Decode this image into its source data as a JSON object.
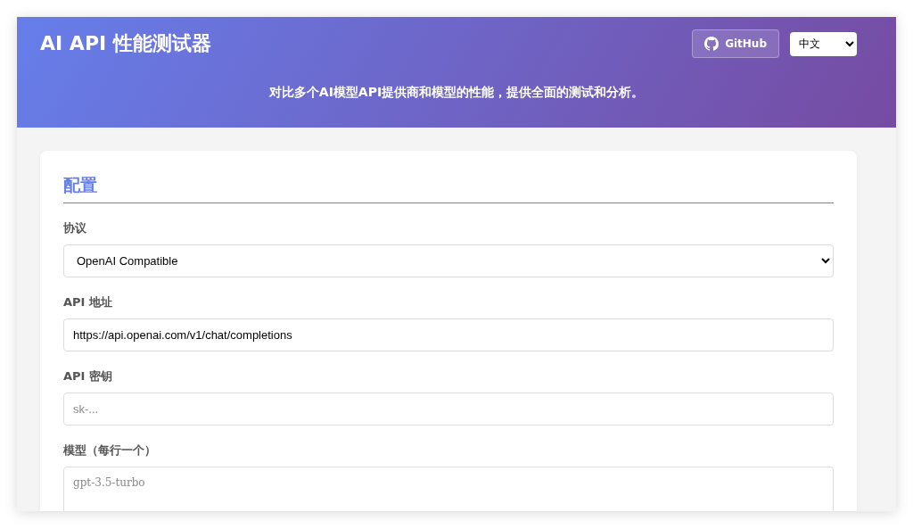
{
  "header": {
    "title": "AI API 性能测试器",
    "github_button": "GitHub",
    "language_select": "中文",
    "subtitle": "对比多个AI模型API提供商和模型的性能，提供全面的测试和分析。"
  },
  "config": {
    "heading": "配置",
    "fields": [
      {
        "kind": "select",
        "label": "协议",
        "value": "OpenAI Compatible"
      },
      {
        "kind": "input",
        "label": "API 地址",
        "value": "https://api.openai.com/v1/chat/completions"
      },
      {
        "kind": "input",
        "label": "API 密钥",
        "placeholder": "sk-..."
      },
      {
        "kind": "textarea",
        "label": "模型（每行一个）",
        "placeholder": "gpt-3.5-turbo"
      }
    ]
  }
}
